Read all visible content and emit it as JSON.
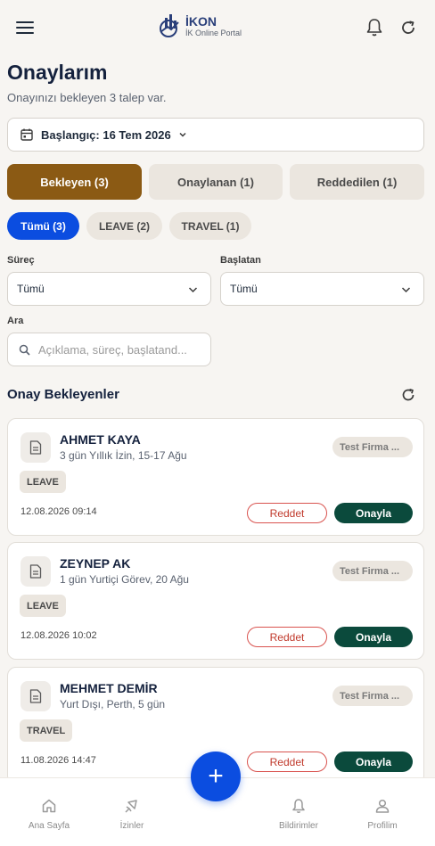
{
  "header": {
    "logo_title": "İKON",
    "logo_subtitle": "İK Online Portal"
  },
  "page": {
    "title": "Onaylarım",
    "subtitle": "Onayınızı bekleyen 3 talep var."
  },
  "date_filter": {
    "label": "Başlangıç: 16 Tem 2026"
  },
  "status_tabs": [
    {
      "label": "Bekleyen (3)",
      "active": true
    },
    {
      "label": "Onaylanan (1)",
      "active": false
    },
    {
      "label": "Reddedilen (1)",
      "active": false
    }
  ],
  "type_chips": [
    {
      "label": "Tümü (3)",
      "active": true
    },
    {
      "label": "LEAVE (2)",
      "active": false
    },
    {
      "label": "TRAVEL (1)",
      "active": false
    }
  ],
  "filters": {
    "process_label": "Süreç",
    "process_value": "Tümü",
    "initiator_label": "Başlatan",
    "initiator_value": "Tümü",
    "search_label": "Ara",
    "search_placeholder": "Açıklama, süreç, başlatand..."
  },
  "section": {
    "title": "Onay Bekleyenler"
  },
  "requests": [
    {
      "name": "AHMET KAYA",
      "description": "3 gün Yıllık İzin, 15-17 Ağu",
      "company": "Test Firma ...",
      "type": "LEAVE",
      "date": "12.08.2026 09:14",
      "reject_label": "Reddet",
      "approve_label": "Onayla"
    },
    {
      "name": "ZEYNEP AK",
      "description": "1 gün Yurtiçi Görev, 20 Ağu",
      "company": "Test Firma ...",
      "type": "LEAVE",
      "date": "12.08.2026 10:02",
      "reject_label": "Reddet",
      "approve_label": "Onayla"
    },
    {
      "name": "MEHMET DEMİR",
      "description": "Yurt Dışı, Perth, 5 gün",
      "company": "Test Firma ...",
      "type": "TRAVEL",
      "date": "11.08.2026 14:47",
      "reject_label": "Reddet",
      "approve_label": "Onayla"
    }
  ],
  "bottom_nav": [
    {
      "label": "Ana Sayfa",
      "icon": "home-icon"
    },
    {
      "label": "İzinler",
      "icon": "plane-icon"
    },
    {
      "label": "Bildirimler",
      "icon": "bell-icon"
    },
    {
      "label": "Profilim",
      "icon": "person-icon"
    }
  ],
  "fab": {
    "icon": "plus-icon",
    "symbol": "+"
  },
  "colors": {
    "accent_brown": "#8b5a14",
    "chip_blue": "#0b4de0",
    "approve_green": "#0b4a3c",
    "reject_red": "#c0392b"
  }
}
